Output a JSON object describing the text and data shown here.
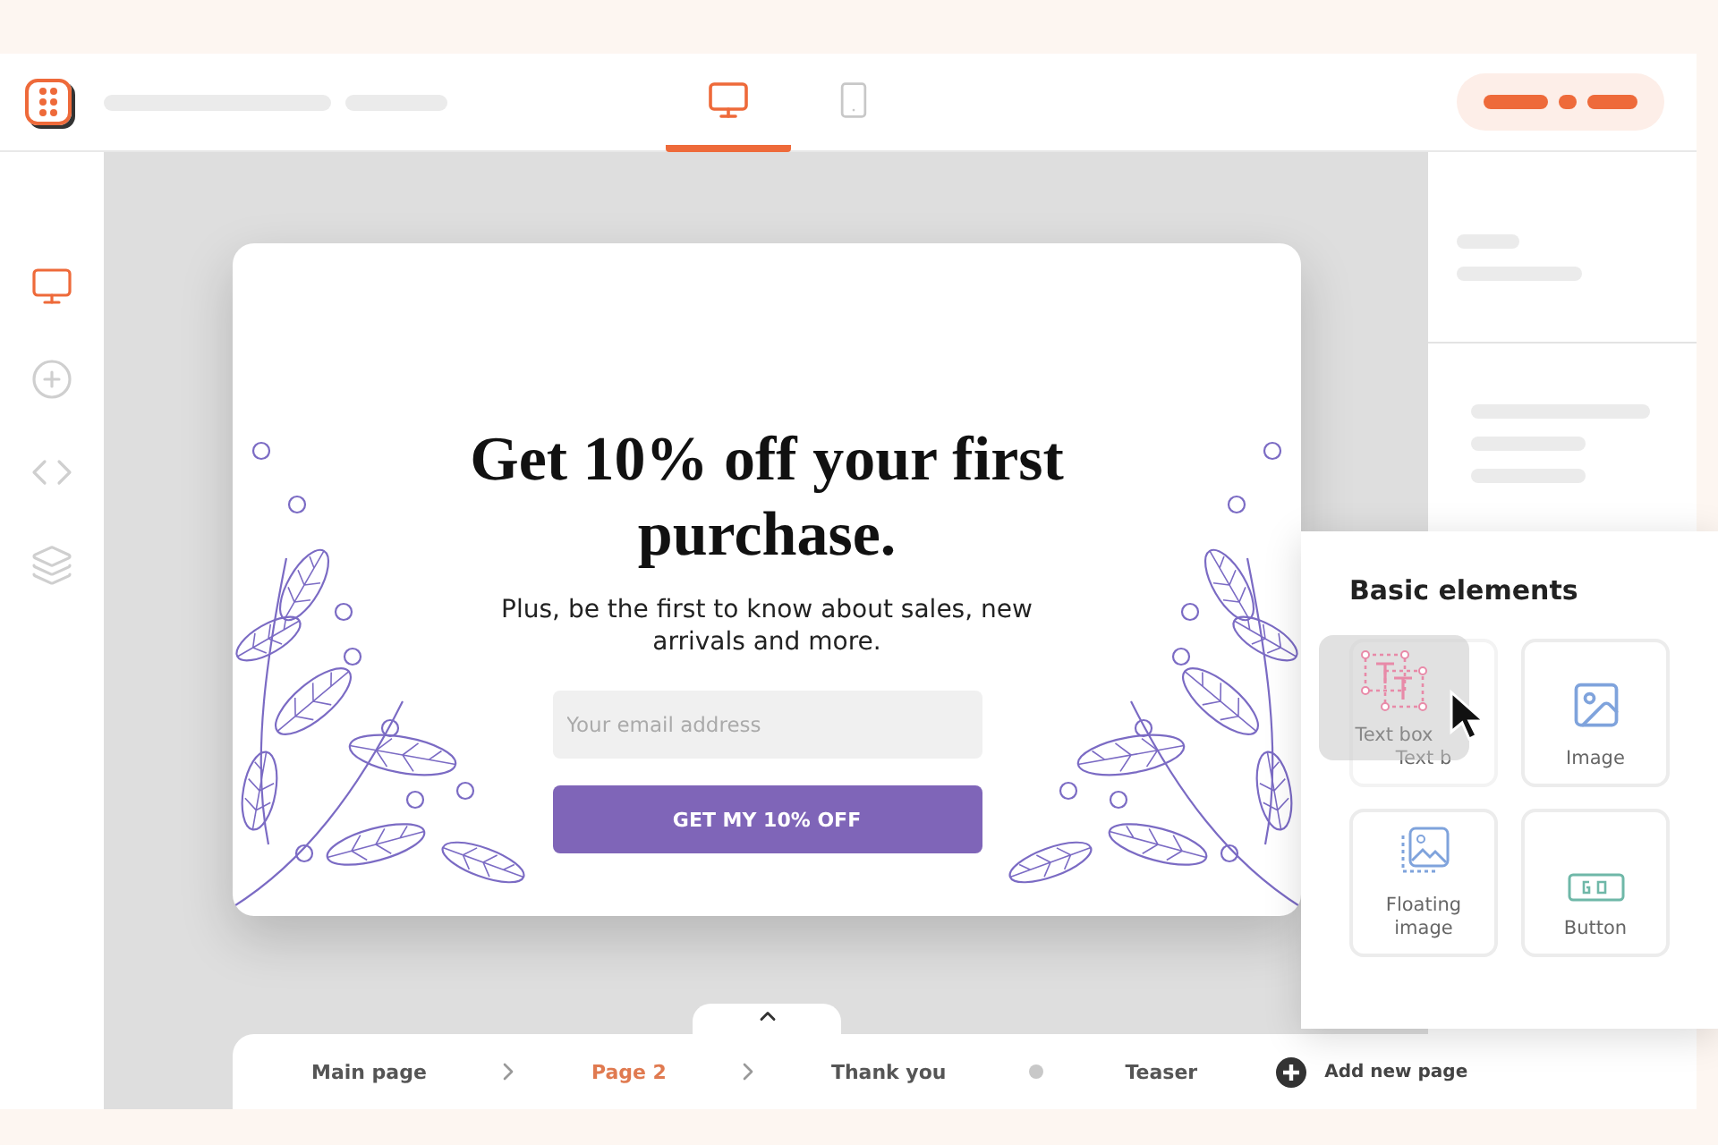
{
  "device_tabs": [
    {
      "kind": "desktop",
      "selected": true
    },
    {
      "kind": "mobile",
      "selected": false
    }
  ],
  "sidebar": {
    "items": [
      {
        "kind": "desktop",
        "selected": true
      },
      {
        "kind": "add",
        "selected": false
      },
      {
        "kind": "code",
        "selected": false
      },
      {
        "kind": "layers",
        "selected": false
      }
    ]
  },
  "popup": {
    "heading": "Get 10% off your first purchase.",
    "subtext": "Plus, be the first to know about sales, new arrivals and more.",
    "email": {
      "placeholder": "Your email address"
    },
    "button": "GET MY 10% OFF"
  },
  "elements_panel": {
    "title": "Basic elements",
    "drag_ghost": {
      "label": "Text box"
    },
    "items": [
      {
        "kind": "text",
        "label": "Text b",
        "dragging": true
      },
      {
        "kind": "image",
        "label": "Image",
        "dragging": false
      },
      {
        "kind": "floating",
        "label": "Floating image",
        "dragging": false
      },
      {
        "kind": "button",
        "label": "Button",
        "dragging": false
      }
    ]
  },
  "pages": {
    "items": [
      {
        "kind": "page",
        "label": "Main page",
        "selected": false
      },
      {
        "kind": "chevron"
      },
      {
        "kind": "page",
        "label": "Page 2",
        "selected": true
      },
      {
        "kind": "chevron"
      },
      {
        "kind": "page",
        "label": "Thank you",
        "selected": false
      },
      {
        "kind": "dot"
      },
      {
        "kind": "page",
        "label": "Teaser",
        "selected": false
      }
    ],
    "add_label": "Add new page"
  }
}
